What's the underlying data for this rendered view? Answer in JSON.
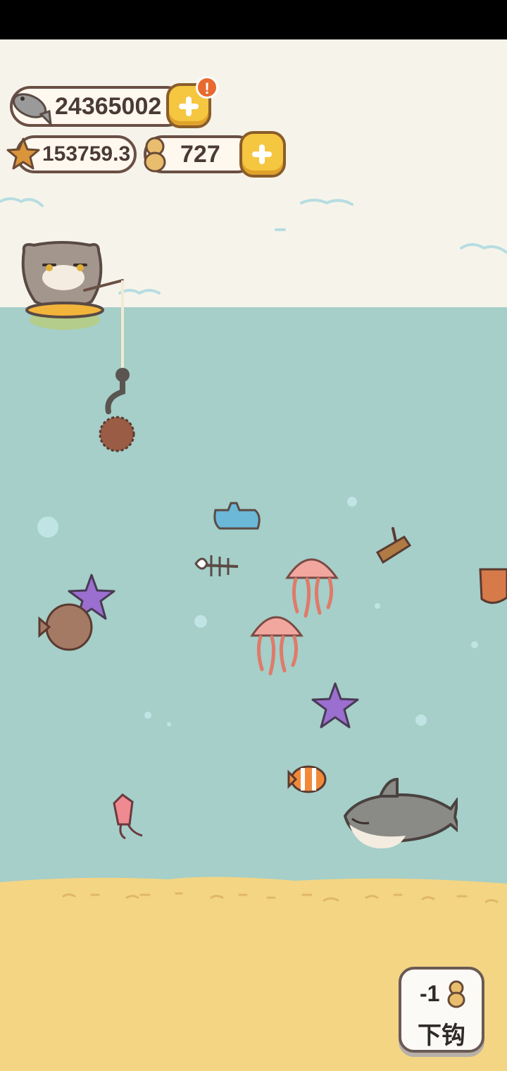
{
  "currency": {
    "fish_count": "24365002",
    "starfish_count": "153759.3",
    "bait_count": "727",
    "alert_mark": "!"
  },
  "cast_button": {
    "cost": "-1",
    "label": "下钩"
  },
  "colors": {
    "sea": "#a5cfc8",
    "sand": "#f3d584",
    "sky": "#f6f4ea",
    "gold_button": "#f5c640"
  },
  "icons": [
    "fish-icon",
    "starfish-icon",
    "peanut-icon",
    "plus-icon",
    "alert-icon"
  ]
}
